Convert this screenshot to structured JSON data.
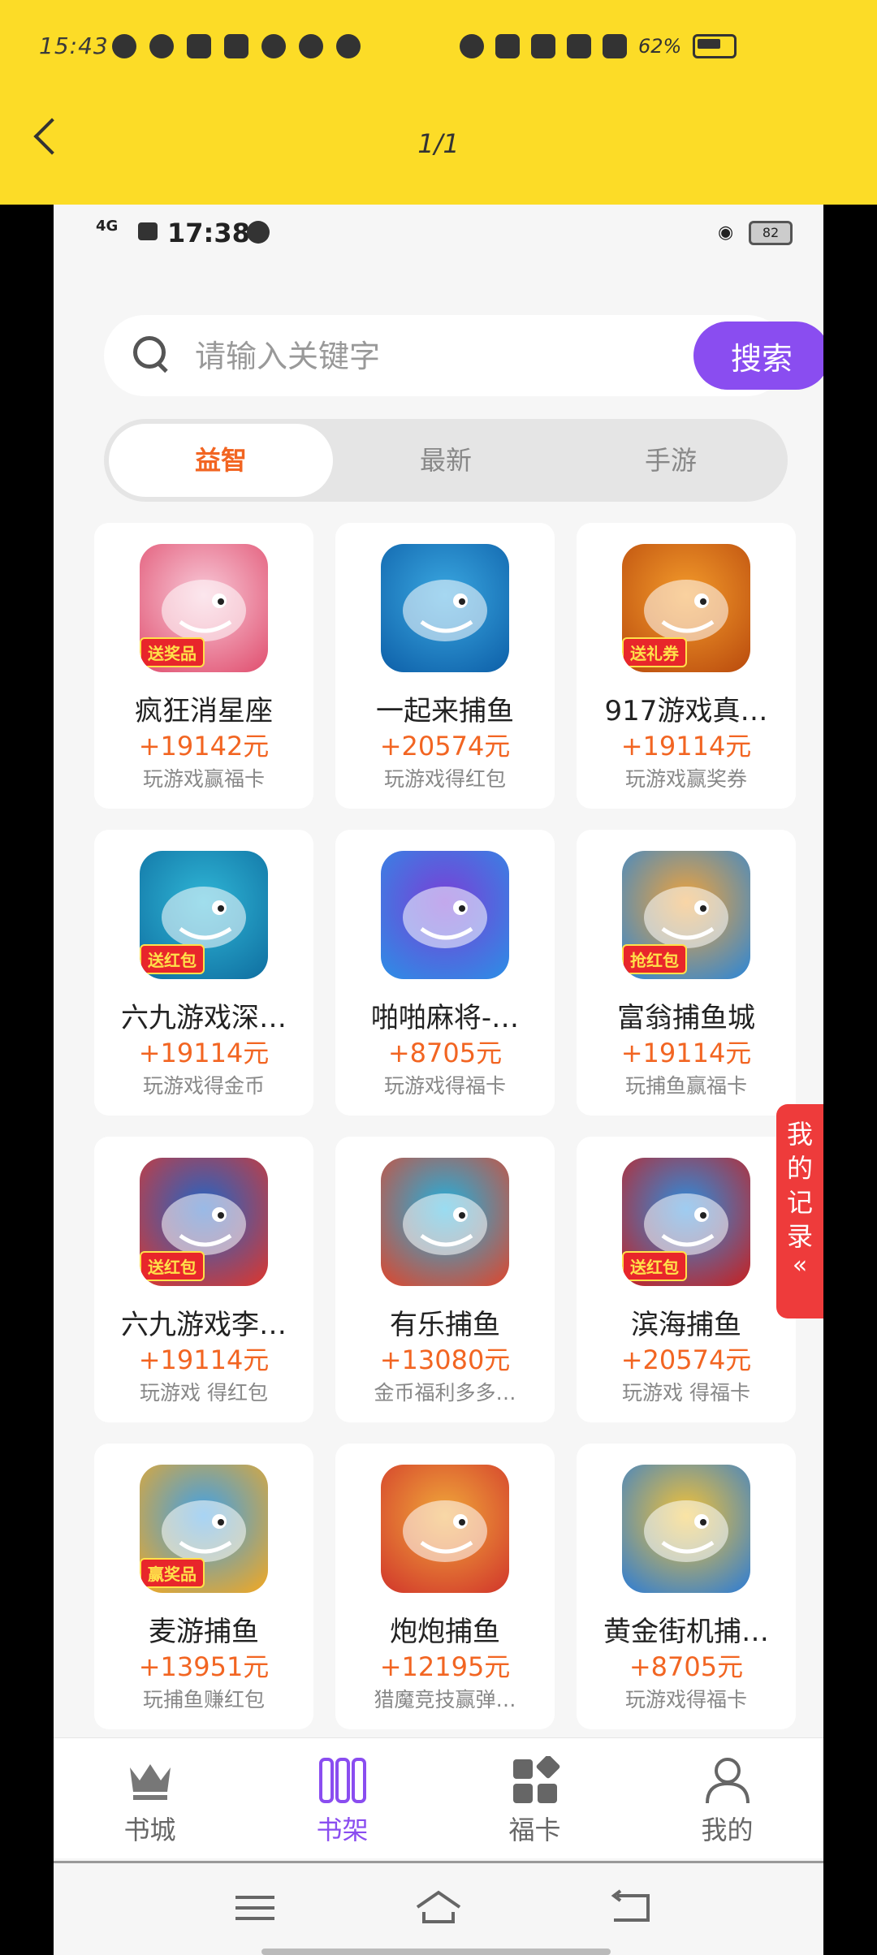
{
  "outer": {
    "time": "15:43",
    "battery_text": "62%",
    "page_counter": "1/1"
  },
  "inner_status": {
    "network": "4G",
    "time": "17:38",
    "battery": "82"
  },
  "search": {
    "placeholder": "请输入关键字",
    "button_label": "搜索"
  },
  "tabs": [
    {
      "label": "益智",
      "active": true
    },
    {
      "label": "最新",
      "active": false
    },
    {
      "label": "手游",
      "active": false
    }
  ],
  "games": [
    {
      "title": "疯狂消星座",
      "amount": "+19142元",
      "desc": "玩游戏赢福卡",
      "badge": "送奖品"
    },
    {
      "title": "一起来捕鱼",
      "amount": "+20574元",
      "desc": "玩游戏得红包",
      "badge": ""
    },
    {
      "title": "917游戏真…",
      "amount": "+19114元",
      "desc": "玩游戏赢奖券",
      "badge": "送礼券"
    },
    {
      "title": "六九游戏深…",
      "amount": "+19114元",
      "desc": "玩游戏得金币",
      "badge": "送红包"
    },
    {
      "title": "啪啪麻将-…",
      "amount": "+8705元",
      "desc": "玩游戏得福卡",
      "badge": ""
    },
    {
      "title": "富翁捕鱼城",
      "amount": "+19114元",
      "desc": "玩捕鱼赢福卡",
      "badge": "抢红包"
    },
    {
      "title": "六九游戏李…",
      "amount": "+19114元",
      "desc": "玩游戏 得红包",
      "badge": "送红包"
    },
    {
      "title": "有乐捕鱼",
      "amount": "+13080元",
      "desc": "金币福利多多…",
      "badge": ""
    },
    {
      "title": "滨海捕鱼",
      "amount": "+20574元",
      "desc": "玩游戏 得福卡",
      "badge": "送红包"
    },
    {
      "title": "麦游捕鱼",
      "amount": "+13951元",
      "desc": "玩捕鱼赚红包",
      "badge": "赢奖品"
    },
    {
      "title": "炮炮捕鱼",
      "amount": "+12195元",
      "desc": "猎魔竞技赢弹…",
      "badge": ""
    },
    {
      "title": "黄金街机捕…",
      "amount": "+8705元",
      "desc": "玩游戏得福卡",
      "badge": ""
    }
  ],
  "record_tab": {
    "label_chars": [
      "我",
      "的",
      "记",
      "录"
    ],
    "chevron": "«"
  },
  "bottom_nav": [
    {
      "label": "书城",
      "icon": "crown-icon",
      "active": false
    },
    {
      "label": "书架",
      "icon": "bookshelf-icon",
      "active": true
    },
    {
      "label": "福卡",
      "icon": "cards-grid-icon",
      "active": false
    },
    {
      "label": "我的",
      "icon": "person-icon",
      "active": false
    }
  ],
  "colors": {
    "outer_bar": "#fcdc27",
    "accent_purple": "#8a4df0",
    "accent_orange": "#f26522",
    "record_red": "#ee3b3b"
  }
}
